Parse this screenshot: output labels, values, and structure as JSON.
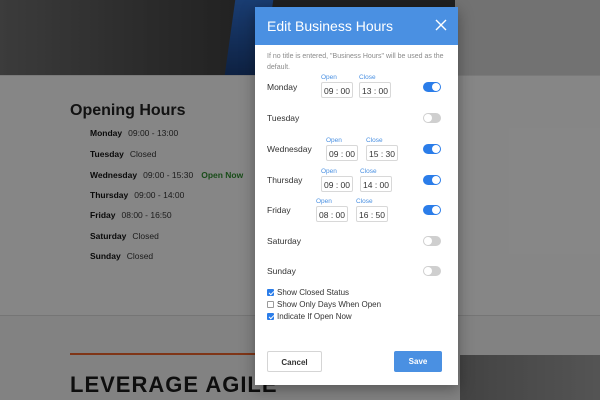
{
  "background": {
    "section_title": "Opening Hours",
    "hours": [
      {
        "day": "Monday",
        "time": "09:00 - 13:00",
        "status": ""
      },
      {
        "day": "Tuesday",
        "time": "Closed",
        "status": ""
      },
      {
        "day": "Wednesday",
        "time": "09:00 - 15:30",
        "status": "Open Now"
      },
      {
        "day": "Thursday",
        "time": "09:00 - 14:00",
        "status": ""
      },
      {
        "day": "Friday",
        "time": "08:00 - 16:50",
        "status": ""
      },
      {
        "day": "Saturday",
        "time": "Closed",
        "status": ""
      },
      {
        "day": "Sunday",
        "time": "Closed",
        "status": ""
      }
    ],
    "banner_text": "LEVERAGE AGILE"
  },
  "modal": {
    "title": "Edit Business Hours",
    "close_icon": "close-icon",
    "note": "If no title is entered, \"Business Hours\" will be used as the default.",
    "open_label": "Open",
    "close_label": "Close",
    "days": [
      {
        "name": "Monday",
        "enabled": true,
        "open_h": "09",
        "open_m": "00",
        "close_h": "13",
        "close_m": "00"
      },
      {
        "name": "Tuesday",
        "enabled": false
      },
      {
        "name": "Wednesday",
        "enabled": true,
        "open_h": "09",
        "open_m": "00",
        "close_h": "15",
        "close_m": "30"
      },
      {
        "name": "Thursday",
        "enabled": true,
        "open_h": "09",
        "open_m": "00",
        "close_h": "14",
        "close_m": "00"
      },
      {
        "name": "Friday",
        "enabled": true,
        "open_h": "08",
        "open_m": "00",
        "close_h": "16",
        "close_m": "50"
      },
      {
        "name": "Saturday",
        "enabled": false
      },
      {
        "name": "Sunday",
        "enabled": false
      }
    ],
    "times": {
      "monday_open": "09 : 00",
      "monday_close": "13 : 00",
      "wednesday_open": "09 : 00",
      "wednesday_close": "15 : 30",
      "thursday_open": "09 : 00",
      "thursday_close": "14 : 00",
      "friday_open": "08 : 00",
      "friday_close": "16 : 50"
    },
    "options": [
      {
        "label": "Show Closed Status",
        "checked": true
      },
      {
        "label": "Show Only Days When Open",
        "checked": false
      },
      {
        "label": "Indicate If Open Now",
        "checked": true
      }
    ],
    "cancel_label": "Cancel",
    "save_label": "Save"
  },
  "colors": {
    "header": "#4a90e2",
    "toggle_on": "#2b7de9",
    "toggle_off": "#cfcfcf",
    "open_now": "#2e8b2e"
  }
}
